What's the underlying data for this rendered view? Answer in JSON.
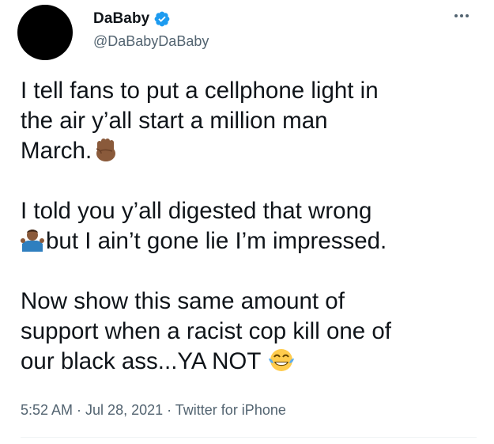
{
  "author": {
    "display_name": "DaBaby",
    "handle": "@DaBabyDaBaby",
    "verified": true
  },
  "tweet": {
    "paragraph1": {
      "line1": "I tell fans to put a cellphone light in",
      "line2": "the air y’all start a million man",
      "line3": "March."
    },
    "paragraph2": {
      "line1": "I told you y’all digested that wrong",
      "line2": "but I ain’t gone lie I’m impressed."
    },
    "paragraph3": {
      "line1": "Now show this same amount of",
      "line2": "support when a racist cop kill one of",
      "line3": "our black ass...YA NOT"
    },
    "emojis": {
      "fist": "raised-fist-medium-dark-skin",
      "shrug": "person-shrugging-medium-dark-skin",
      "laugh": "face-with-tears-of-joy"
    }
  },
  "meta": {
    "time": "5:52 AM",
    "sep1": " · ",
    "date": "Jul 28, 2021",
    "sep2": " · ",
    "source": "Twitter for iPhone"
  },
  "colors": {
    "text": "#0f1419",
    "secondary": "#536471",
    "verified_blue": "#1d9bf0"
  }
}
